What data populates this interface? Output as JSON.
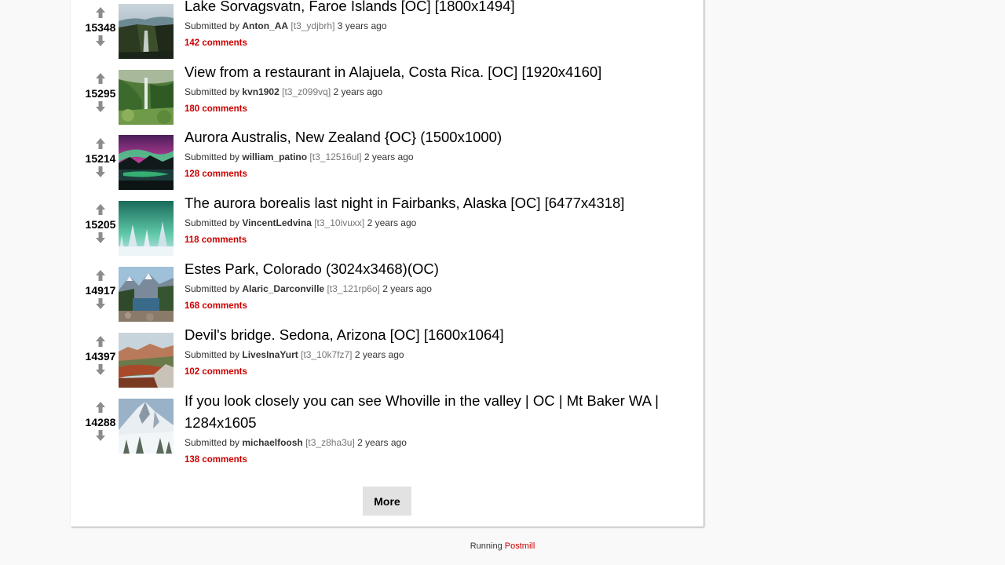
{
  "submissions": [
    {
      "score": "15348",
      "title": "Lake Sorvagsvatn, Faroe Islands [OC] [1800x1494]",
      "submitted_by": "Submitted by",
      "user": "Anton_AA",
      "id": "[t3_ydjbrh]",
      "age": "3 years ago",
      "comments": "142 comments"
    },
    {
      "score": "15295",
      "title": "View from a restaurant in Alajuela, Costa Rica. [OC] [1920x4160]",
      "submitted_by": "Submitted by",
      "user": "kvn1902",
      "id": "[t3_z099vq]",
      "age": "2 years ago",
      "comments": "180 comments"
    },
    {
      "score": "15214",
      "title": "Aurora Australis, New Zealand {OC} (1500x1000)",
      "submitted_by": "Submitted by",
      "user": "william_patino",
      "id": "[t3_12516ul]",
      "age": "2 years ago",
      "comments": "128 comments"
    },
    {
      "score": "15205",
      "title": "The aurora borealis last night in Fairbanks, Alaska [OC] [6477x4318]",
      "submitted_by": "Submitted by",
      "user": "VincentLedvina",
      "id": "[t3_10ivuxx]",
      "age": "2 years ago",
      "comments": "118 comments"
    },
    {
      "score": "14917",
      "title": "Estes Park, Colorado (3024x3468)(OC)",
      "submitted_by": "Submitted by",
      "user": "Alaric_Darconville",
      "id": "[t3_121rp6o]",
      "age": "2 years ago",
      "comments": "168 comments"
    },
    {
      "score": "14397",
      "title": "Devil's bridge. Sedona, Arizona [OC] [1600x1064]",
      "submitted_by": "Submitted by",
      "user": "LivesInaYurt",
      "id": "[t3_10k7fz7]",
      "age": "2 years ago",
      "comments": "102 comments"
    },
    {
      "score": "14288",
      "title": "If you look closely you can see Whoville in the valley | OC | Mt Baker WA | 1284x1605",
      "submitted_by": "Submitted by",
      "user": "michaelfoosh",
      "id": "[t3_z8ha3u]",
      "age": "2 years ago",
      "comments": "138 comments"
    }
  ],
  "more_label": "More",
  "footer": {
    "running": "Running",
    "link": "Postmill"
  },
  "icons": {
    "upvote": "arrow-up-icon",
    "downvote": "arrow-down-icon"
  },
  "colors": {
    "accent": "#cc0000",
    "arrow": "#8c8c8c",
    "button_bg": "#e2e2e2"
  }
}
